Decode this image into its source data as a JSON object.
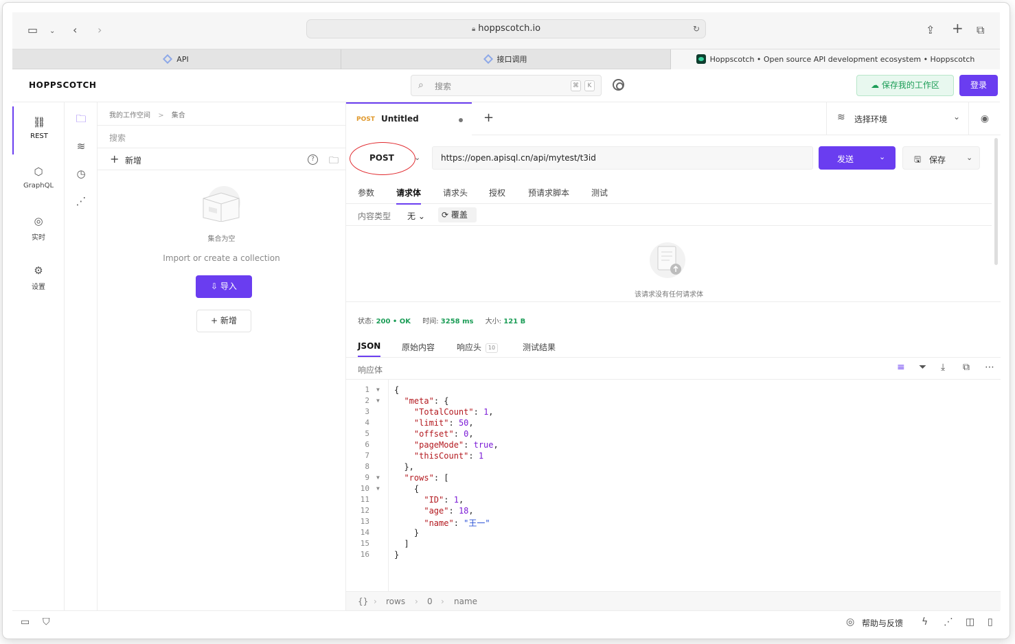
{
  "browser": {
    "url": "hoppscotch.io",
    "tabs": [
      {
        "title": "API"
      },
      {
        "title": "接口调用"
      },
      {
        "title": "Hoppscotch • Open source API development ecosystem • Hoppscotch"
      }
    ]
  },
  "header": {
    "logo": "HOPPSCOTCH",
    "search_placeholder": "搜索",
    "kbd1": "⌘",
    "kbd2": "K",
    "save_workspace": "保存我的工作区",
    "login": "登录"
  },
  "leftnav": {
    "items": [
      {
        "label": "REST"
      },
      {
        "label": "GraphQL"
      },
      {
        "label": "实时"
      },
      {
        "label": "设置"
      }
    ]
  },
  "collections": {
    "breadcrumb_root": "我的工作空间",
    "breadcrumb_sep": ">",
    "breadcrumb_current": "集合",
    "search_placeholder": "搜索",
    "new_label": "新增",
    "empty_title": "集合为空",
    "empty_subtitle": "Import or create a collection",
    "import_button": "导入",
    "new_button": "新增"
  },
  "request": {
    "tab_method": "POST",
    "tab_title": "Untitled",
    "environment": "选择环境",
    "method": "POST",
    "url": "https://open.apisql.cn/api/mytest/t3id",
    "send": "发送",
    "save": "保存",
    "subtabs": [
      "参数",
      "请求体",
      "请求头",
      "授权",
      "预请求脚本",
      "测试"
    ],
    "content_type_label": "内容类型",
    "content_type_value": "无",
    "override": "覆盖",
    "no_body": "该请求没有任何请求体"
  },
  "response": {
    "status_label": "状态:",
    "status_value": "200 • OK",
    "time_label": "时间:",
    "time_value": "3258 ms",
    "size_label": "大小:",
    "size_value": "121 B",
    "tabs": [
      "JSON",
      "原始内容",
      "响应头",
      "测试结果"
    ],
    "headers_count": "10",
    "body_label": "响应体",
    "footer_path": [
      "{}",
      "rows",
      "0",
      "name"
    ]
  },
  "statusbar": {
    "help": "帮助与反馈"
  },
  "colors": {
    "accent": "#6a3df0",
    "success": "#1c9d57",
    "method_orange": "#e0982b",
    "annotation_red": "#e0262b"
  }
}
